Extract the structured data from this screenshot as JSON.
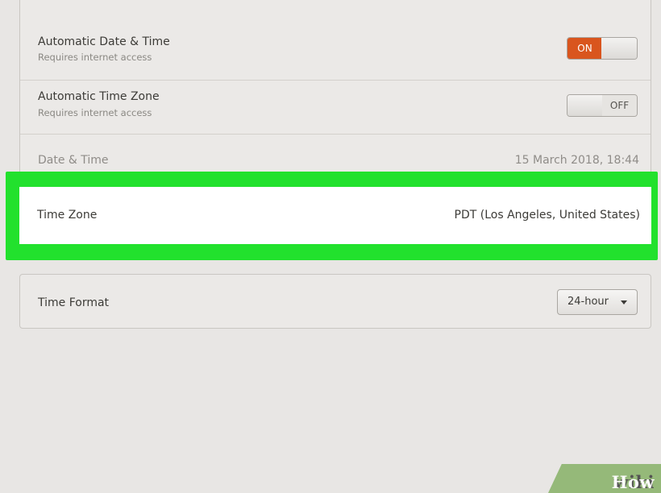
{
  "settings": {
    "auto_date_time": {
      "title": "Automatic Date & Time",
      "subtitle": "Requires internet access",
      "switch_label": "ON",
      "state": "on"
    },
    "auto_time_zone": {
      "title": "Automatic Time Zone",
      "subtitle": "Requires internet access",
      "switch_label": "OFF",
      "state": "off"
    },
    "date_time": {
      "title": "Date & Time",
      "value": "15 March 2018, 18:44"
    },
    "time_zone": {
      "title": "Time Zone",
      "value": "PDT (Los Angeles, United States)"
    },
    "time_format": {
      "title": "Time Format",
      "selected": "24-hour"
    }
  },
  "watermark": {
    "part1": "wiki",
    "part2": "How"
  },
  "colors": {
    "switch_on": "#d9551e",
    "highlight": "#22e12d",
    "watermark_bg": "#86b167"
  }
}
